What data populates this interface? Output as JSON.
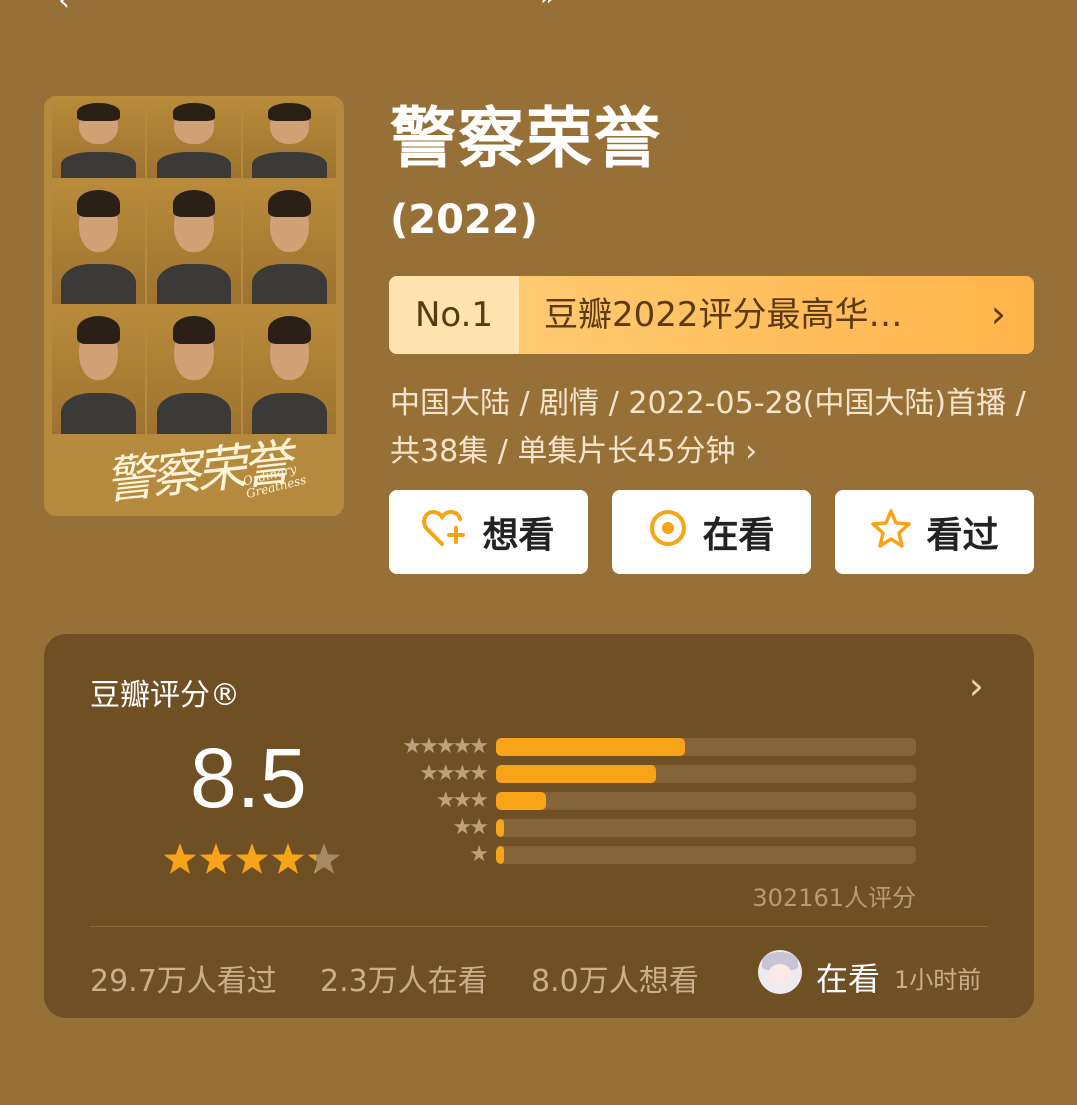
{
  "nav": {
    "back_glyph": "‹",
    "top_glyph": "»"
  },
  "poster": {
    "title_art": "警察荣誉",
    "subtitle_art_1": "Ordinary",
    "subtitle_art_2": "Greatness"
  },
  "show": {
    "title": "警察荣誉",
    "year": "(2022)"
  },
  "rank": {
    "badge": "No.1",
    "text": "豆瓣2022评分最高华…",
    "arrow": "›"
  },
  "meta": {
    "info": "中国大陆 / 剧情 / 2022-05-28(中国大陆)首播 / 共38集 / 单集片长45分钟 ›"
  },
  "actions": [
    {
      "label": "想看",
      "icon": "heart-plus-icon"
    },
    {
      "label": "在看",
      "icon": "target-circle-icon"
    },
    {
      "label": "看过",
      "icon": "star-outline-icon"
    }
  ],
  "rating": {
    "title": "豆瓣评分®",
    "score": "8.5",
    "stars_value": 4.25,
    "votes": "302161人评分",
    "distribution": [
      {
        "stars": "★★★★★",
        "fraction": 0.45
      },
      {
        "stars": "★★★★",
        "fraction": 0.38
      },
      {
        "stars": "★★★",
        "fraction": 0.12
      },
      {
        "stars": "★★",
        "fraction": 0.02
      },
      {
        "stars": "★",
        "fraction": 0.015
      }
    ]
  },
  "stats": {
    "watched": "29.7万人看过",
    "watching": "2.3万人在看",
    "want": "8.0万人想看"
  },
  "activity": {
    "status": "在看",
    "time": "1小时前"
  },
  "colors": {
    "background": "#977037",
    "panel": "#6f4f24",
    "accent": "#f7a418",
    "banner": "#ffb44a"
  }
}
